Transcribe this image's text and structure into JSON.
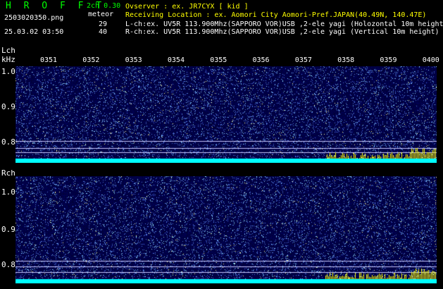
{
  "header": {
    "app_name": "H R O F F T",
    "version": "2ch 0.30",
    "meteor_label": "meteor",
    "filename": "2503020350.png",
    "timestamp": "25.03.02 03:50",
    "lch_count": "29",
    "rch_count": "40"
  },
  "info": {
    "observer": "Ovserver              : ex. JR7CYX [ kid ]",
    "location": "Receiving Location : ex. Aomori City Aomori-Pref.JAPAN(40.49N, 140.47E)",
    "lch": "L-ch:ex. UV5R 113.900Mhz(SAPPORO VOR)USB ,2-ele yagi (Holozontal 10m height)",
    "rch": "R-ch:ex. UV5R 113.900Mhz(SAPPORO VOR)USB ,2-ele yagi (Vertical 10m height)"
  },
  "lch_panel": {
    "label": "Lch",
    "unit": "kHz",
    "time_ticks": [
      "0351",
      "0352",
      "0353",
      "0354",
      "0355",
      "0356",
      "0357",
      "0358",
      "0359",
      "0400"
    ],
    "y_ticks": [
      "1.0",
      "0.9",
      "0.8"
    ]
  },
  "rch_panel": {
    "label": "Rch",
    "y_ticks": [
      "1.0",
      "0.9",
      "0.8"
    ]
  },
  "colors": {
    "background": "#000000",
    "spectrogram_base": "#000060",
    "marker_yellow": "#ffff00",
    "marker_cyan": "#00ffff",
    "title_green": "#00ff00"
  }
}
